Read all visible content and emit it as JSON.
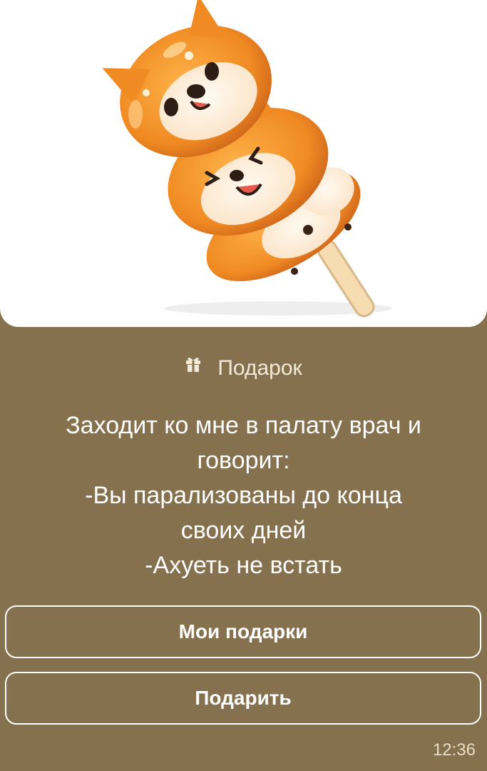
{
  "gift_card": {
    "image_icon": "shiba-dango-candy-illustration",
    "header_icon": "gift-icon",
    "header_label": "Подарок",
    "message_lines": [
      "Заходит ко мне в палату врач и",
      "говорит:",
      "-Вы парализованы до конца",
      "своих дней",
      "-Ахуеть не встать"
    ],
    "buttons": {
      "my_gifts": "Мои подарки",
      "give": "Подарить"
    },
    "time": "12:36"
  },
  "colors": {
    "background": "#86714f",
    "image_bg": "#ffffff",
    "text": "#ffffff"
  }
}
